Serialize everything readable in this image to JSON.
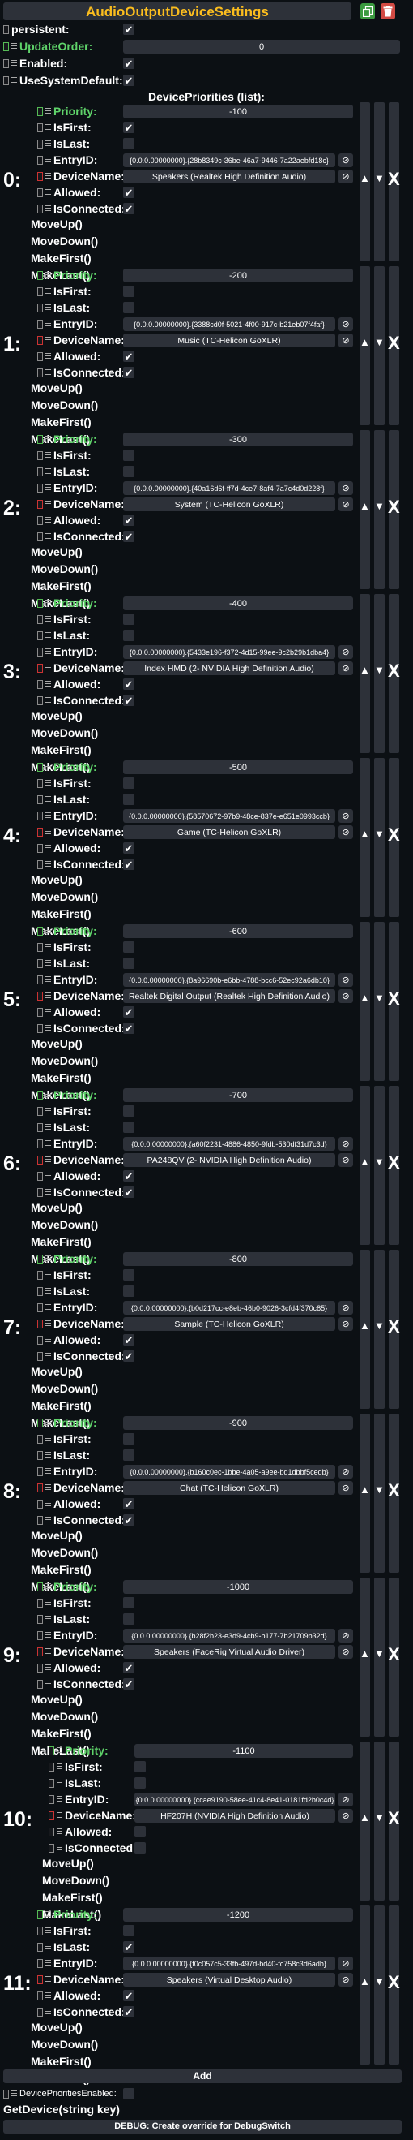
{
  "header": {
    "title": "AudioOutputDeviceSettings",
    "copy_icon": "copy-icon",
    "delete_icon": "trash-icon"
  },
  "fields": {
    "persistent_label": "persistent:",
    "update_order_label": "UpdateOrder:",
    "update_order_value": "0",
    "enabled_label": "Enabled:",
    "use_system_default_label": "UseSystemDefault:"
  },
  "list_header": "DevicePriorities (list):",
  "labels": {
    "priority": "Priority:",
    "is_first": "IsFirst:",
    "is_last": "IsLast:",
    "entry_id": "EntryID:",
    "device_name": "DeviceName:",
    "allowed": "Allowed:",
    "is_connected": "IsConnected:",
    "move_up": "MoveUp()",
    "move_down": "MoveDown()",
    "make_first": "MakeFirst()",
    "make_last": "MakeLast()"
  },
  "items": [
    {
      "index": "0:",
      "priority": "-100",
      "entry_id": "{0.0.0.00000000}.{28b8349c-36be-46a7-9446-7a22aebfd18c}",
      "device_name": "Speakers (Realtek High Definition Audio)",
      "is_first": true,
      "is_last": false,
      "allowed": true,
      "is_connected": true
    },
    {
      "index": "1:",
      "priority": "-200",
      "entry_id": "{0.0.0.00000000}.{3388cd0f-5021-4f00-917c-b21eb07f4faf}",
      "device_name": "Music (TC-Helicon GoXLR)",
      "is_first": false,
      "is_last": false,
      "allowed": true,
      "is_connected": true
    },
    {
      "index": "2:",
      "priority": "-300",
      "entry_id": "{0.0.0.00000000}.{40a16d6f-ff7d-4ce7-8af4-7a7c4d0d228f}",
      "device_name": "System (TC-Helicon GoXLR)",
      "is_first": false,
      "is_last": false,
      "allowed": true,
      "is_connected": true
    },
    {
      "index": "3:",
      "priority": "-400",
      "entry_id": "{0.0.0.00000000}.{5433e196-f372-4d15-99ee-9c2b29b1dba4}",
      "device_name": "Index HMD (2- NVIDIA High Definition Audio)",
      "is_first": false,
      "is_last": false,
      "allowed": true,
      "is_connected": true
    },
    {
      "index": "4:",
      "priority": "-500",
      "entry_id": "{0.0.0.00000000}.{58570672-97b9-48ce-837e-e651e0993ccb}",
      "device_name": "Game (TC-Helicon GoXLR)",
      "is_first": false,
      "is_last": false,
      "allowed": true,
      "is_connected": true
    },
    {
      "index": "5:",
      "priority": "-600",
      "entry_id": "{0.0.0.00000000}.{8a96690b-e6bb-4788-bcc6-52ec92a6db10}",
      "device_name": "Realtek Digital Output (Realtek High Definition Audio)",
      "is_first": false,
      "is_last": false,
      "allowed": true,
      "is_connected": true
    },
    {
      "index": "6:",
      "priority": "-700",
      "entry_id": "{0.0.0.00000000}.{a60f2231-4886-4850-9fdb-530df31d7c3d}",
      "device_name": "PA248QV (2- NVIDIA High Definition Audio)",
      "is_first": false,
      "is_last": false,
      "allowed": true,
      "is_connected": true
    },
    {
      "index": "7:",
      "priority": "-800",
      "entry_id": "{0.0.0.00000000}.{b0d217cc-e8eb-46b0-9026-3cfd4f370c85}",
      "device_name": "Sample (TC-Helicon GoXLR)",
      "is_first": false,
      "is_last": false,
      "allowed": true,
      "is_connected": true
    },
    {
      "index": "8:",
      "priority": "-900",
      "entry_id": "{0.0.0.00000000}.{b160c0ec-1bbe-4a05-a9ee-bd1dbbf5cedb}",
      "device_name": "Chat (TC-Helicon GoXLR)",
      "is_first": false,
      "is_last": false,
      "allowed": true,
      "is_connected": true
    },
    {
      "index": "9:",
      "priority": "-1000",
      "entry_id": "{0.0.0.00000000}.{b28f2b23-e3d9-4cb9-b177-7b21709b32d}",
      "device_name": "Speakers (FaceRig Virtual Audio Driver)",
      "is_first": false,
      "is_last": false,
      "allowed": true,
      "is_connected": true
    },
    {
      "index": "10:",
      "priority": "-1100",
      "entry_id": "{0.0.0.00000000}.{ccae9190-58ee-41c4-8e41-0181fd2b0c4d}",
      "device_name": "HF207H (NVIDIA High Definition Audio)",
      "is_first": false,
      "is_last": false,
      "allowed": false,
      "is_connected": false
    },
    {
      "index": "11:",
      "priority": "-1200",
      "entry_id": "{0.0.0.00000000}.{f0c057c5-33fb-497d-bd40-fc758c3d6adb}",
      "device_name": "Speakers (Virtual Desktop Audio)",
      "is_first": false,
      "is_last": true,
      "allowed": true,
      "is_connected": true
    }
  ],
  "add_label": "Add",
  "device_priorities_enabled_label": "DevicePrioritiesEnabled:",
  "get_device_label": "GetDevice(string key)",
  "debug_label": "DEBUG: Create override for DebugSwitch",
  "colors": {
    "accent": "#fbbd1e",
    "green": "#5fd36a",
    "panel": "#2d3139",
    "background": "#0c1014",
    "copy": "#3a9a3f",
    "delete": "#d24a43"
  }
}
